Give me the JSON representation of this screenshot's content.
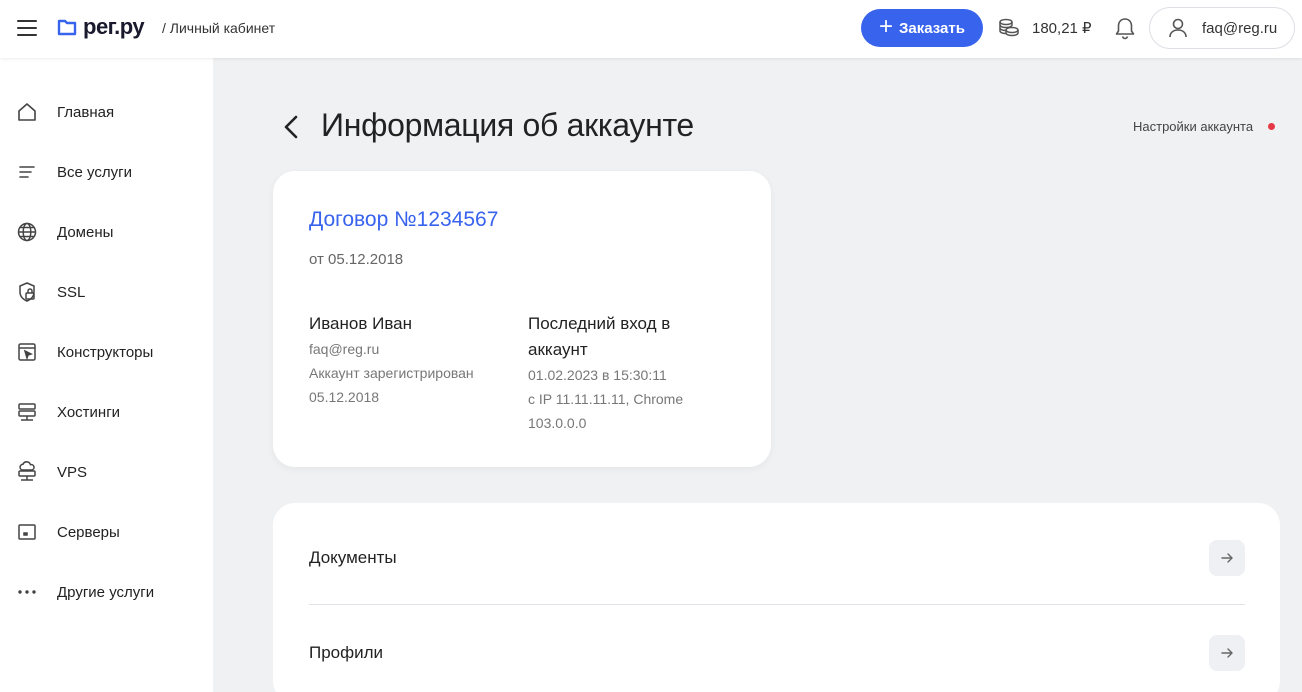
{
  "header": {
    "logo_text": "рег.ру",
    "breadcrumb": "/ Личный кабинет",
    "order_label": "Заказать",
    "balance": "180,21 ₽",
    "account_email": "faq@reg.ru"
  },
  "sidebar": {
    "items": [
      {
        "label": "Главная",
        "icon": "home-icon"
      },
      {
        "label": "Все услуги",
        "icon": "list-icon"
      },
      {
        "label": "Домены",
        "icon": "globe-icon"
      },
      {
        "label": "SSL",
        "icon": "shield-lock-icon"
      },
      {
        "label": "Конструкторы",
        "icon": "constructor-icon"
      },
      {
        "label": "Хостинги",
        "icon": "hosting-icon"
      },
      {
        "label": "VPS",
        "icon": "cloud-server-icon"
      },
      {
        "label": "Серверы",
        "icon": "server-icon"
      },
      {
        "label": "Другие услуги",
        "icon": "more-dots-icon"
      }
    ]
  },
  "main": {
    "title": "Информация об аккаунте",
    "settings_link": "Настройки аккаунта",
    "contract": {
      "number": "Договор №1234567",
      "date": "от 05.12.2018",
      "owner": {
        "name": "Иванов Иван",
        "email": "faq@reg.ru",
        "registered_label": "Аккаунт зарегистрирован",
        "registered_date": "05.12.2018"
      },
      "last_login": {
        "title_line1": "Последний вход в",
        "title_line2": "аккаунт",
        "datetime": "01.02.2023 в 15:30:11",
        "ip_line1": "с IP 11.11.11.11, Chrome",
        "ip_line2": "103.0.0.0"
      }
    },
    "list": [
      {
        "label": "Документы"
      },
      {
        "label": "Профили"
      }
    ]
  },
  "colors": {
    "accent": "#3863ed",
    "notification_dot": "#e63946"
  }
}
